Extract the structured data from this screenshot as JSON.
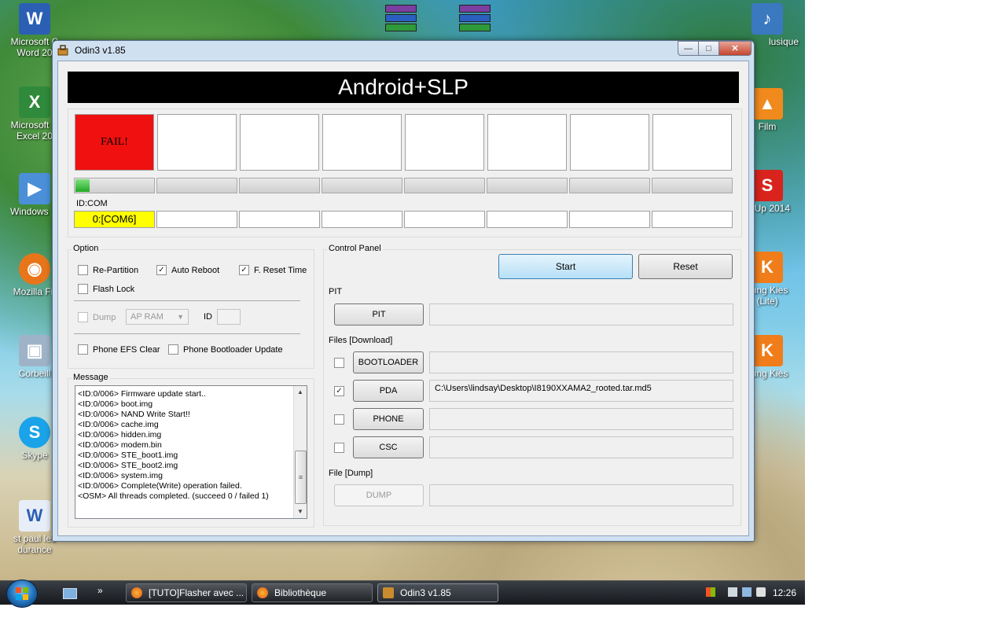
{
  "desktop": {
    "left_icons": [
      {
        "label": "Microsoft Office Word 2007",
        "short": "Microsoft C\nWord 20",
        "glyph": "W",
        "color": "#2b5fb3"
      },
      {
        "label": "Microsoft Office Excel 2007",
        "short": "Microsoft C\nExcel 20",
        "glyph": "X",
        "color": "#2f8a3c"
      },
      {
        "label": "Windows Media",
        "short": "Windows M",
        "glyph": "▶",
        "color": "#4a8fd8"
      },
      {
        "label": "Mozilla Firefox",
        "short": "Mozilla Fir",
        "glyph": "◉",
        "color": "#e8751a"
      },
      {
        "label": "Corbeille",
        "short": "Corbeill",
        "glyph": "🗑",
        "color": "#9fb3c8"
      },
      {
        "label": "Skype",
        "short": "Skype",
        "glyph": "S",
        "color": "#1aa3e8"
      },
      {
        "label": "st paul les durance",
        "short": "st paul les\ndurance",
        "glyph": "W",
        "color": "#2b5fb3"
      }
    ],
    "right_icons": [
      {
        "short": "Musique",
        "glyph": "♪",
        "color": "#3a78c0"
      },
      {
        "short": "Film",
        "glyph": "▲",
        "color": "#f08a1c"
      },
      {
        "short": "SketchUp 2014",
        "glyph": "S",
        "color": "#d8241c"
      },
      {
        "short": "Samsung Kies (Lite)",
        "glyph": "K",
        "color": "#f07d1a"
      },
      {
        "short": "Samsung Kies",
        "glyph": "K",
        "color": "#f07d1a"
      }
    ],
    "right_labels": [
      "lusique",
      "Film",
      "chUp 2014",
      "sung Kies\n(Lite)",
      "sung Kies"
    ]
  },
  "window": {
    "title": "Odin3 v1.85",
    "minimize_glyph": "—",
    "maximize_glyph": "□",
    "close_glyph": "✕"
  },
  "banner": "Android+SLP",
  "slots": [
    {
      "status": "FAIL!",
      "progress_percent": 20,
      "com": "0:[COM6]"
    },
    {
      "status": "",
      "progress_percent": 0,
      "com": ""
    },
    {
      "status": "",
      "progress_percent": 0,
      "com": ""
    },
    {
      "status": "",
      "progress_percent": 0,
      "com": ""
    },
    {
      "status": "",
      "progress_percent": 0,
      "com": ""
    },
    {
      "status": "",
      "progress_percent": 0,
      "com": ""
    },
    {
      "status": "",
      "progress_percent": 0,
      "com": ""
    },
    {
      "status": "",
      "progress_percent": 0,
      "com": ""
    }
  ],
  "id_com_label": "ID:COM",
  "option": {
    "title": "Option",
    "re_partition": {
      "label": "Re-Partition",
      "checked": false
    },
    "auto_reboot": {
      "label": "Auto Reboot",
      "checked": true
    },
    "f_reset_time": {
      "label": "F. Reset Time",
      "checked": true
    },
    "flash_lock": {
      "label": "Flash Lock",
      "checked": false
    },
    "dump": {
      "label": "Dump",
      "checked": false
    },
    "dump_source": "AP RAM",
    "id_label": "ID",
    "phone_efs_clear": {
      "label": "Phone EFS Clear",
      "checked": false
    },
    "phone_bootloader_update": {
      "label": "Phone Bootloader Update",
      "checked": false
    }
  },
  "message": {
    "title": "Message",
    "lines": [
      "<ID:0/006> Firmware update start..",
      "<ID:0/006> boot.img",
      "<ID:0/006> NAND Write Start!!",
      "<ID:0/006> cache.img",
      "<ID:0/006> hidden.img",
      "<ID:0/006> modem.bin",
      "<ID:0/006> STE_boot1.img",
      "<ID:0/006> STE_boot2.img",
      "<ID:0/006> system.img",
      "<ID:0/006> Complete(Write) operation failed.",
      "<OSM> All threads completed. (succeed 0 / failed 1)"
    ]
  },
  "control_panel": {
    "title": "Control Panel",
    "start": "Start",
    "reset": "Reset"
  },
  "pit": {
    "title": "PIT",
    "button": "PIT",
    "path": ""
  },
  "files": {
    "title": "Files [Download]",
    "bootloader": {
      "label": "BOOTLOADER",
      "checked": false,
      "path": ""
    },
    "pda": {
      "label": "PDA",
      "checked": true,
      "path": "C:\\Users\\lindsay\\Desktop\\I8190XXAMA2_rooted.tar.md5"
    },
    "phone": {
      "label": "PHONE",
      "checked": false,
      "path": ""
    },
    "csc": {
      "label": "CSC",
      "checked": false,
      "path": ""
    }
  },
  "dump": {
    "title": "File [Dump]",
    "button": "DUMP",
    "path": ""
  },
  "taskbar": {
    "quick_more": "»",
    "items": [
      {
        "label": "[TUTO]Flasher avec ...",
        "active": false
      },
      {
        "label": "Bibliothèque",
        "active": false
      },
      {
        "label": "Odin3 v1.85",
        "active": true
      }
    ],
    "clock": "12:26"
  }
}
